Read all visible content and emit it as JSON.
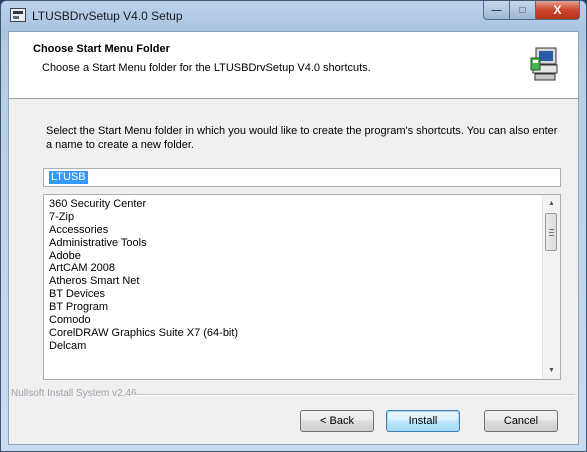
{
  "window": {
    "title": "LTUSBDrvSetup V4.0 Setup",
    "controls": {
      "minimize": "—",
      "maximize": "□",
      "close": "X"
    }
  },
  "header": {
    "title": "Choose Start Menu Folder",
    "subtitle": "Choose a Start Menu folder for the LTUSBDrvSetup V4.0 shortcuts.",
    "icon": "installer-computer-icon"
  },
  "description": "Select the Start Menu folder in which you would like to create the program's shortcuts. You can also enter a name to create a new folder.",
  "folder_input": {
    "value": "LTUSB"
  },
  "folder_list": {
    "items": [
      "360 Security Center",
      "7-Zip",
      "Accessories",
      "Administrative Tools",
      "Adobe",
      "ArtCAM 2008",
      "Atheros Smart Net",
      "BT Devices",
      "BT Program",
      "Comodo",
      "CorelDRAW Graphics Suite X7 (64-bit)",
      "Delcam"
    ]
  },
  "branding": "Nullsoft Install System v2.46",
  "buttons": {
    "back": "< Back",
    "install": "Install",
    "cancel": "Cancel"
  }
}
